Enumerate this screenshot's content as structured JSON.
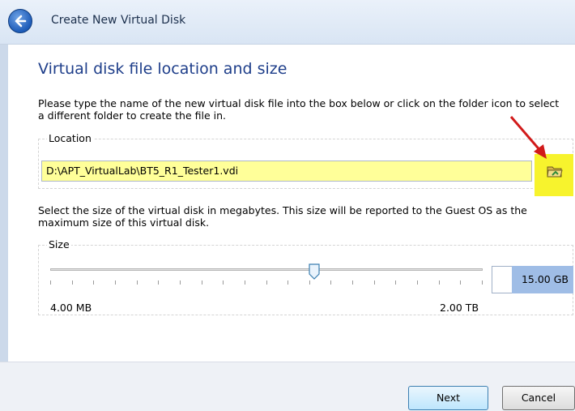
{
  "window": {
    "title": "Create New Virtual Disk"
  },
  "page": {
    "heading": "Virtual disk file location and size",
    "location_description": "Please type the name of the new virtual disk file into the box below or click on the folder icon to select a different folder to create the file in.",
    "size_description": "Select the size of the virtual disk in megabytes. This size will be reported to the Guest OS as the maximum size of this virtual disk."
  },
  "location": {
    "group_label": "Location",
    "value": "D:\\APT_VirtualLab\\BT5_R1_Tester1.vdi",
    "folder_icon": "folder-icon"
  },
  "size": {
    "group_label": "Size",
    "value": "15.00 GB",
    "min_label": "4.00 MB",
    "max_label": "2.00 TB",
    "slider_fraction": 0.61
  },
  "buttons": {
    "next": "Next",
    "cancel": "Cancel"
  },
  "colors": {
    "highlight_yellow": "#ffff99",
    "folder_highlight": "#f7f32d",
    "size_highlight": "#9fbde6",
    "heading_blue": "#1e3e8a"
  }
}
